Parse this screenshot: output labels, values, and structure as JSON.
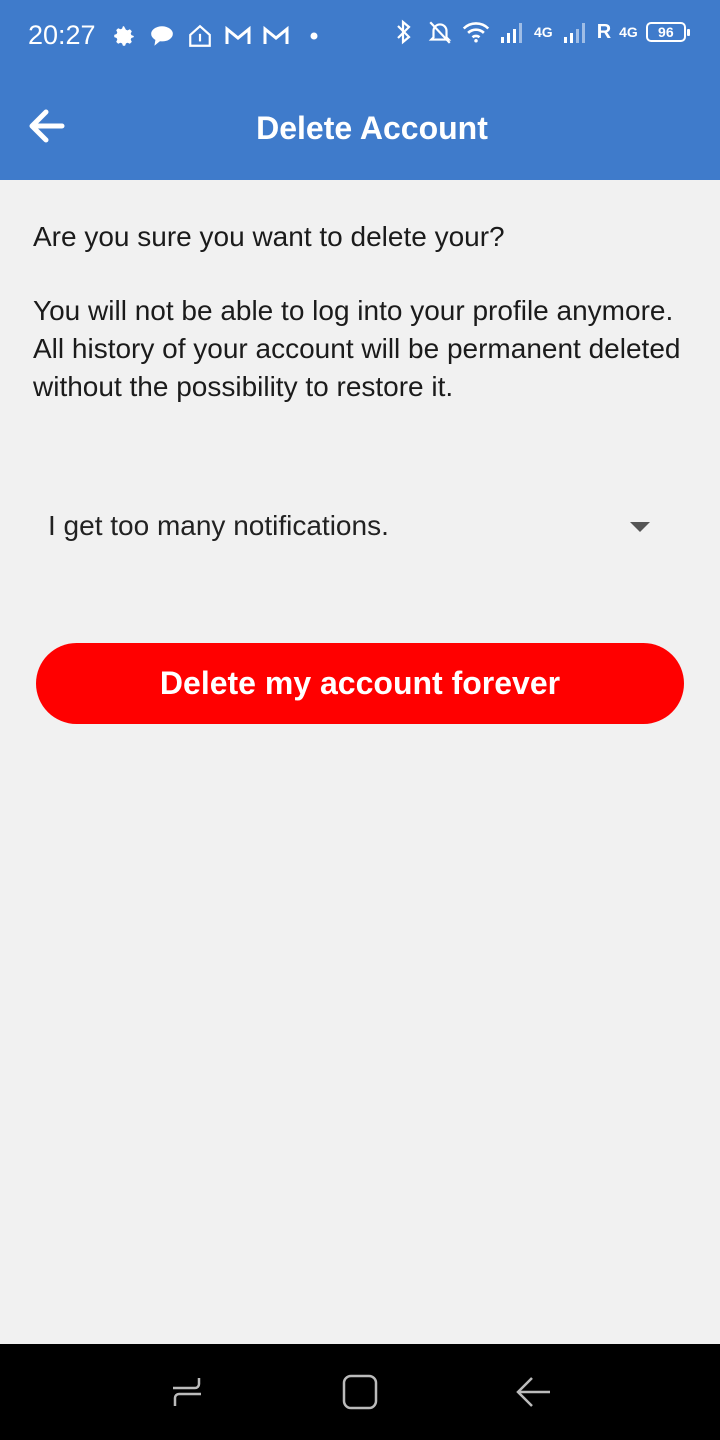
{
  "status_bar": {
    "time": "20:27",
    "network_label_1": "4G",
    "roaming_label": "R",
    "network_label_2": "4G",
    "battery": "96"
  },
  "app_bar": {
    "title": "Delete Account",
    "background_color": "#3f7bcb"
  },
  "content": {
    "question": "Are you sure you want to delete your?",
    "warning": "You will not be able to log into your profile anymore. All history of your account will be permanent deleted without the possibility to restore it."
  },
  "reason_dropdown": {
    "selected": "I get too many notifications."
  },
  "delete_button": {
    "label": "Delete my account forever",
    "color": "#ff0000"
  },
  "nav_bar": {
    "icons": [
      "recents-icon",
      "home-icon",
      "back-icon"
    ]
  }
}
